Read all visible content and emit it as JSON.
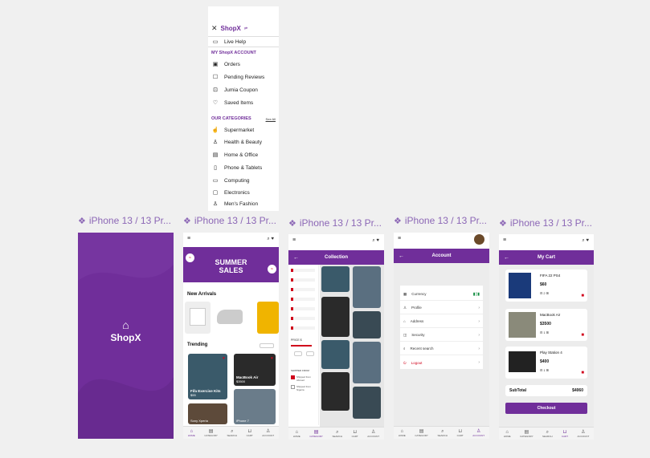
{
  "frame_label": "iPhone 13 / 13 Pr...",
  "colors": {
    "primary": "#702e9a",
    "danger": "#d0021b",
    "background": "#f0f0f0"
  },
  "drawer": {
    "brand": "ShopX",
    "live_help": "Live Help",
    "account_heading": "MY ShopX ACCOUNT",
    "account_items": [
      "Orders",
      "Pending Reviews",
      "Jumia Coupon",
      "Saved Items"
    ],
    "categories_heading": "OUR CATEGORIES",
    "see_all": "See All",
    "category_items": [
      "Supermarket",
      "Health & Beauty",
      "Home & Office",
      "Phone & Tablets",
      "Computing",
      "Electronics",
      "Men's Fashion"
    ]
  },
  "splash": {
    "brand": "ShopX"
  },
  "home": {
    "banner_title": "SUMMER SALES",
    "new_arrivals": "New Arrivals",
    "trending": "Trending",
    "trending_items": [
      {
        "name": "Fifa Exercise Kits",
        "price": "$55"
      },
      {
        "name": "MacBook Air",
        "price": "$3500"
      },
      {
        "name": "Sony Xperia",
        "price": ""
      },
      {
        "name": "iPhone 7",
        "price": ""
      }
    ]
  },
  "collection": {
    "title": "Collection",
    "price_label": "PRICE $",
    "shipping_label": "SHIPPED FROM",
    "shipping_options": [
      "Shipped from Abroad",
      "Shipped from Nigeria"
    ]
  },
  "account": {
    "title": "Account",
    "rows": [
      "Currency",
      "Profile",
      "Address",
      "Security",
      "Recent search",
      "Logout"
    ]
  },
  "cart": {
    "title": "My Cart",
    "items": [
      {
        "name": "FIFA 22 PS4",
        "price": "$60",
        "qty": "2"
      },
      {
        "name": "MacBook Air",
        "price": "$3500",
        "qty": "1"
      },
      {
        "name": "Play Station 4",
        "price": "$400",
        "qty": "1"
      }
    ],
    "subtotal_label": "SubTotal",
    "subtotal_value": "$4060",
    "checkout": "Checkout"
  },
  "nav_items": [
    "HOME",
    "CATEGORY",
    "SEARCH",
    "CART",
    "ACCOUNT"
  ]
}
